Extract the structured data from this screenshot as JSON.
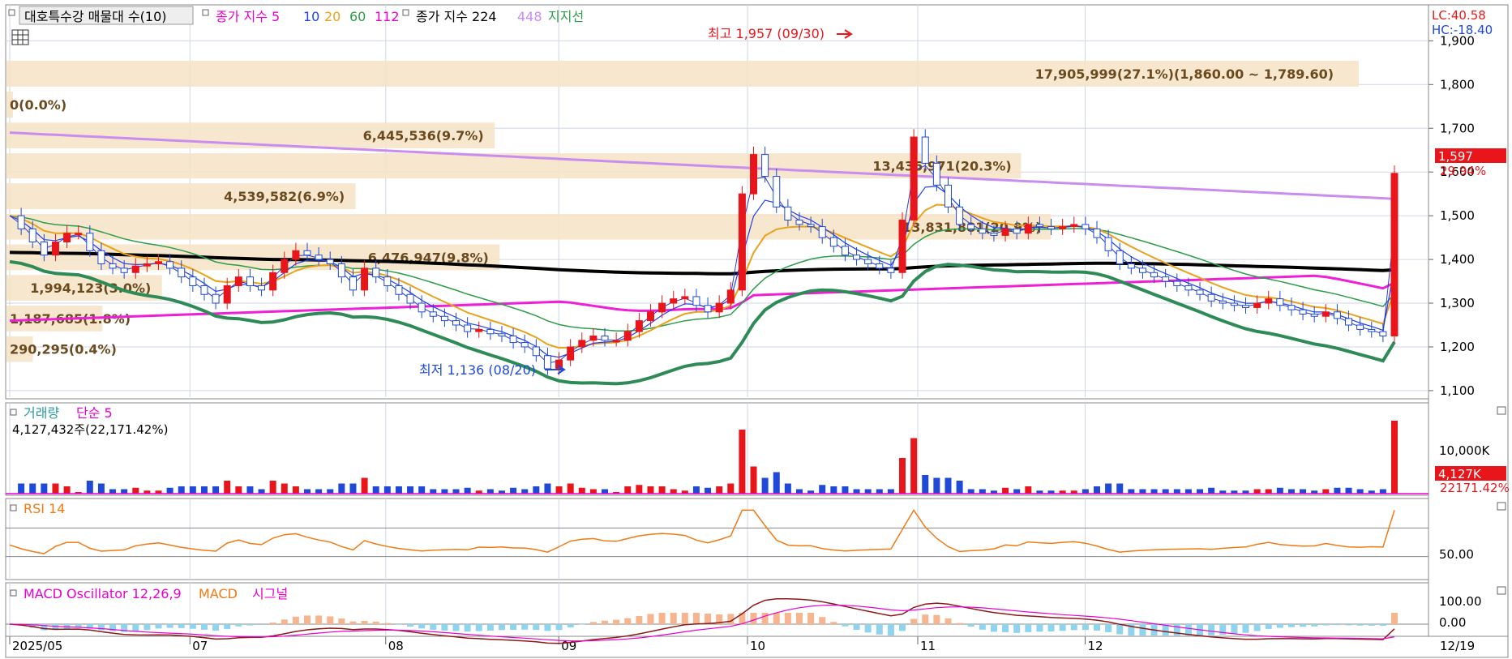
{
  "chart_data": [
    {
      "type": "candlestick",
      "title": "대호특수강 매물대 수(10)",
      "x_ticks": [
        "2025/05",
        "07",
        "08",
        "09",
        "10",
        "11",
        "12"
      ],
      "x_end_label": "12/19",
      "y_ticks": [
        "1,900",
        "1,800",
        "1,700",
        "1,600",
        "1,500",
        "1,400",
        "1,300",
        "1,200",
        "1,100"
      ],
      "ylim": [
        1085,
        1960
      ],
      "legend": {
        "title_box": "대호특수강 매물대 수(10)",
        "ma_prefix": "종가 지수 5",
        "ma10": "10",
        "ma20": "20",
        "ma60": "60",
        "ma112": "112",
        "ma224_prefix": "종가 지수 224",
        "ma448": "448",
        "support": "지지선"
      },
      "lc_label": "LC:40.58",
      "hc_label": "HC:-18.40",
      "last_price": "1,597",
      "last_change": "29.94%",
      "high_annotation": "최고 1,957 (09/30)",
      "low_annotation": "최저 1,136 (08/20)",
      "volume_profile": [
        {
          "label": "17,905,999(27.1%)(1,860.00 ~ 1,789.60)",
          "price_low": 1789.6,
          "price_high": 1860,
          "share": 27.1
        },
        {
          "label": "13,436,971(20.3%)",
          "price_low": 1579.8,
          "price_high": 1648.5,
          "share": 20.3
        },
        {
          "label": "6,445,536(9.7%)",
          "price_low": 1648.5,
          "price_high": 1718.5,
          "share": 9.7
        },
        {
          "label": "4,539,582(6.9%)",
          "price_low": 1509.5,
          "price_high": 1579.8,
          "share": 6.9
        },
        {
          "label": "13,831,881(20.9%)",
          "price_low": 1440,
          "price_high": 1509.5,
          "share": 20.9
        },
        {
          "label": "6,476,947(9.8%)",
          "price_low": 1370,
          "price_high": 1440,
          "share": 9.8
        },
        {
          "label": "1,994,123(3.0%)",
          "price_low": 1300,
          "price_high": 1370,
          "share": 3.0
        },
        {
          "label": "1,187,685(1.8%)",
          "price_low": 1230,
          "price_high": 1300,
          "share": 1.8
        },
        {
          "label": "290,295(0.4%)",
          "price_low": 1160,
          "price_high": 1230,
          "share": 0.4
        },
        {
          "label": "0(0.0%)",
          "price_low": 1718.5,
          "price_high": 1789.6,
          "share": 0.0
        }
      ],
      "series_colors": {
        "ma5": "#2d3ec9",
        "ma10": "#1f3ff2",
        "ma20": "#e8a21b",
        "ma60": "#2c9d4a",
        "ma112": "#ee1fd6",
        "ma224": "#000000",
        "ma448": "#c98df0",
        "support": "#2e8a57",
        "up": "#e8161a",
        "down": "#1f49d6"
      },
      "closes": [
        1500,
        1470,
        1440,
        1410,
        1440,
        1460,
        1460,
        1420,
        1390,
        1380,
        1370,
        1385,
        1390,
        1395,
        1380,
        1360,
        1340,
        1320,
        1300,
        1340,
        1360,
        1340,
        1330,
        1370,
        1400,
        1420,
        1410,
        1400,
        1390,
        1360,
        1330,
        1380,
        1360,
        1340,
        1320,
        1300,
        1280,
        1270,
        1260,
        1250,
        1235,
        1240,
        1230,
        1225,
        1210,
        1200,
        1180,
        1150,
        1170,
        1200,
        1215,
        1225,
        1215,
        1215,
        1235,
        1260,
        1280,
        1300,
        1310,
        1315,
        1295,
        1280,
        1300,
        1330,
        1550,
        1640,
        1590,
        1520,
        1490,
        1480,
        1475,
        1450,
        1430,
        1410,
        1400,
        1390,
        1380,
        1370,
        1490,
        1680,
        1620,
        1570,
        1520,
        1480,
        1470,
        1460,
        1455,
        1470,
        1460,
        1480,
        1475,
        1470,
        1475,
        1480,
        1470,
        1450,
        1420,
        1390,
        1380,
        1370,
        1360,
        1350,
        1340,
        1330,
        1320,
        1305,
        1300,
        1295,
        1290,
        1300,
        1310,
        1295,
        1285,
        1275,
        1270,
        1280,
        1265,
        1250,
        1240,
        1235,
        1225,
        1597
      ]
    },
    {
      "type": "bar",
      "title": "거래량",
      "legend_ma": "단순 5",
      "summary": "4,127,432주(22,171.42%)",
      "y_tick": "10,000K",
      "last_volume": "4,127K",
      "last_ratio": "22171.42%"
    },
    {
      "type": "line",
      "title": "RSI 14",
      "y_tick": "50.00",
      "ylim": [
        0,
        100
      ]
    },
    {
      "type": "bar",
      "title": "MACD Oscillator 12,26,9",
      "legend_macd": "MACD",
      "legend_signal": "시그널",
      "y_ticks": [
        "100.00",
        "0.00"
      ]
    }
  ]
}
